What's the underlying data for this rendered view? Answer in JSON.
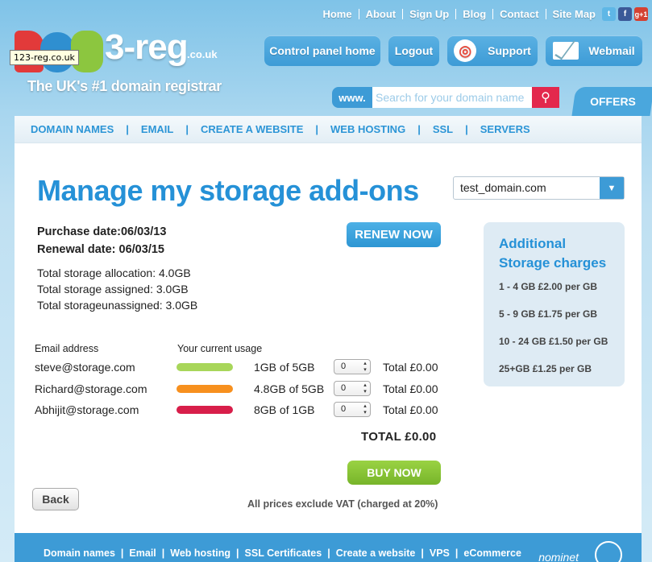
{
  "top_links": [
    "Home",
    "About",
    "Sign Up",
    "Blog",
    "Contact",
    "Site Map"
  ],
  "social": {
    "twitter": "t",
    "facebook": "f",
    "google": "g+1"
  },
  "logo": {
    "text": "3-reg",
    "suffix": ".co.uk",
    "tooltip": "123-reg.co.uk"
  },
  "tagline": "The UK's #1 domain registrar",
  "header_buttons": {
    "control_panel": "Control panel home",
    "logout": "Logout",
    "support": "Support",
    "webmail": "Webmail"
  },
  "search": {
    "prefix": "www.",
    "placeholder": "Search for your domain name"
  },
  "offers": "OFFERS",
  "nav": [
    "DOMAIN NAMES",
    "EMAIL",
    "CREATE A WEBSITE",
    "WEB HOSTING",
    "SSL",
    "SERVERS"
  ],
  "page_title": "Manage my storage add-ons",
  "domain_select": "test_domain.com",
  "purchase_date": "Purchase date:06/03/13",
  "renewal_date": "Renewal date: 06/03/15",
  "renew_button": "RENEW NOW",
  "totals": {
    "allocation": "Total storage allocation: 4.0GB",
    "assigned": "Total storage assigned: 3.0GB",
    "unassigned": "Total storageunassigned: 3.0GB"
  },
  "columns": {
    "email": "Email address",
    "usage": "Your current usage"
  },
  "rows": [
    {
      "email": "steve@storage.com",
      "usage": "1GB of 5GB",
      "qty": "0",
      "total": "Total £0.00",
      "color": "#a8d65a"
    },
    {
      "email": "Richard@storage.com",
      "usage": "4.8GB of 5GB",
      "qty": "0",
      "total": "Total £0.00",
      "color": "#f7901e"
    },
    {
      "email": "Abhijit@storage.com",
      "usage": "8GB of 1GB",
      "qty": "0",
      "total": "Total £0.00",
      "color": "#d81e4a"
    }
  ],
  "grand_total": "TOTAL £0.00",
  "buy_button": "BUY NOW",
  "back_button": "Back",
  "vat_note": "All prices exclude VAT (charged at 20%)",
  "side": {
    "title_line1": "Additional",
    "title_line2": "Storage charges",
    "prices": [
      "1 - 4 GB £2.00 per GB",
      "5 - 9 GB £1.75 per GB",
      "10 - 24  GB £1.50 per GB",
      "25+GB £1.25 per GB"
    ]
  },
  "footer": {
    "links": [
      "Domain names",
      "Email",
      "Web hosting",
      "SSL Certificates",
      "Create a website",
      "VPS",
      "eCommerce"
    ],
    "nominet": "nominet"
  }
}
